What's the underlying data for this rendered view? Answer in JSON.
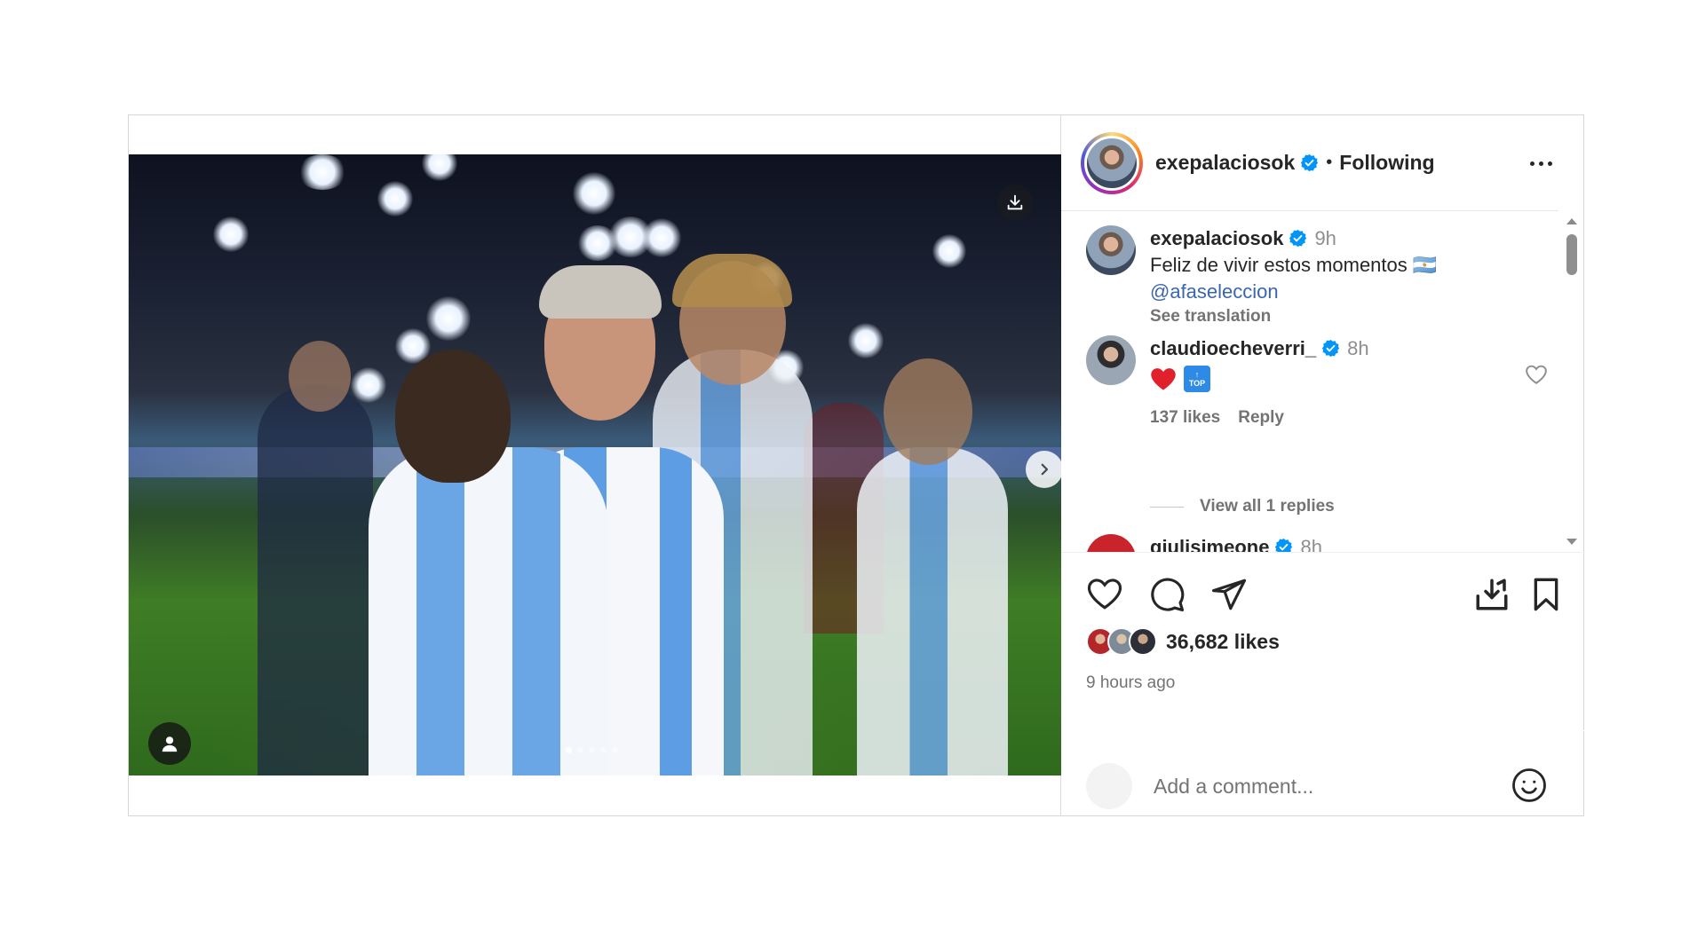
{
  "post": {
    "author": "exepalaciosok",
    "follow_state": "Following",
    "separator": "•",
    "media": {
      "slide_count": 5,
      "active_slide": 1
    }
  },
  "comments": [
    {
      "user": "exepalaciosok",
      "time": "9h",
      "text": "Feliz de vivir estos momentos 🇦🇷",
      "mention": "@afaseleccion",
      "see_translation": "See translation"
    },
    {
      "user": "claudioecheverri_",
      "time": "8h",
      "emojis": [
        "red-heart",
        "top-arrow"
      ],
      "top_label": "TOP",
      "likes": "137 likes",
      "reply": "Reply",
      "view_replies": "View all 1 replies"
    },
    {
      "user": "giulisimeone",
      "time": "8h"
    }
  ],
  "stats": {
    "likes": "36,682 likes",
    "posted": "9 hours ago"
  },
  "add_comment": {
    "placeholder": "Add a comment..."
  },
  "colors": {
    "verified": "#0095f6",
    "text": "#262626",
    "muted": "#737373",
    "mention": "#3a66b0"
  },
  "icons": [
    "download-icon",
    "chevron-right-icon",
    "user-tag-icon",
    "more-icon",
    "heart-icon",
    "comment-icon",
    "share-icon",
    "save-to-device-icon",
    "bookmark-icon",
    "emoji-icon",
    "verified-icon"
  ]
}
